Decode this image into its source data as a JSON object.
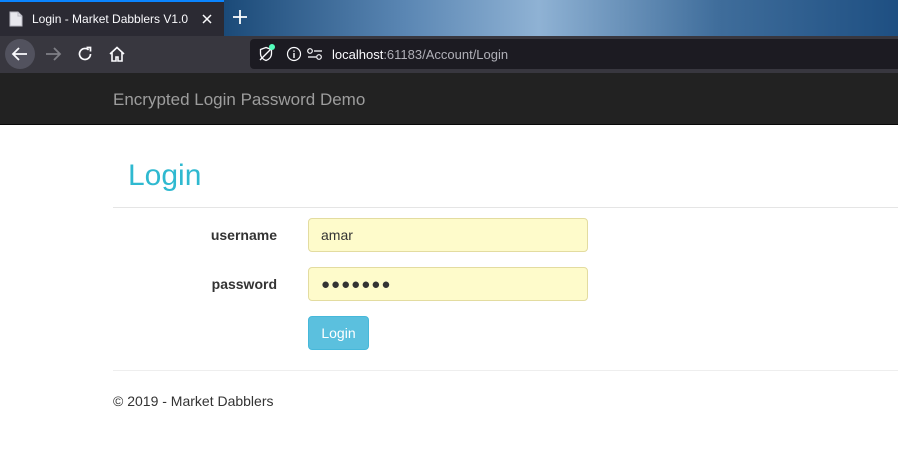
{
  "browser": {
    "tab": {
      "title": "Login - Market Dabblers V1.0",
      "favicon": "page-icon"
    },
    "new_tab": "plus-icon",
    "nav": {
      "back": "arrow-left-icon",
      "forward": "arrow-right-icon",
      "reload": "reload-icon",
      "home": "home-icon"
    },
    "url": {
      "host": "localhost",
      "rest": ":61183/Account/Login"
    }
  },
  "site": {
    "brand": "Encrypted Login Password Demo"
  },
  "login": {
    "title": "Login",
    "username_label": "username",
    "username_value": "amar",
    "password_label": "password",
    "password_value": "●●●●●●●",
    "submit_label": "Login"
  },
  "footer": {
    "text": "© 2019 - Market Dabblers"
  },
  "colors": {
    "accent": "#2fb9d0",
    "button": "#5bc0de",
    "autofill": "#fefbcb",
    "header_bg": "#222222"
  }
}
